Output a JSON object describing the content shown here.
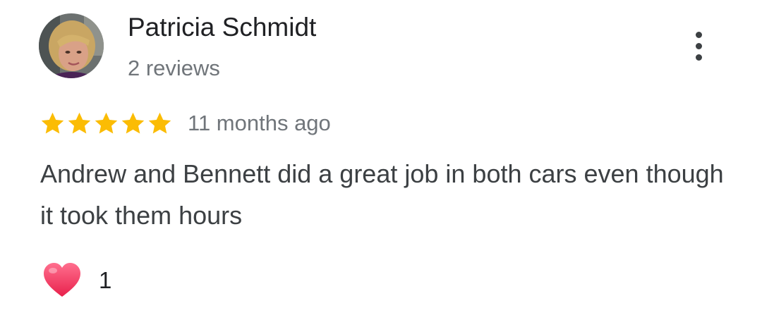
{
  "review": {
    "author": {
      "name": "Patricia Schmidt",
      "review_count": "2 reviews",
      "avatar_icon": "profile-photo"
    },
    "more_options_icon": "more-vertical-icon",
    "rating": {
      "stars": 5,
      "out_of": 5,
      "star_color": "#fbbc04",
      "time": "11 months ago"
    },
    "text": "Andrew and Bennett did a great job in both cars even though it took them hours",
    "reaction": {
      "icon": "heart-icon",
      "count": "1"
    }
  }
}
